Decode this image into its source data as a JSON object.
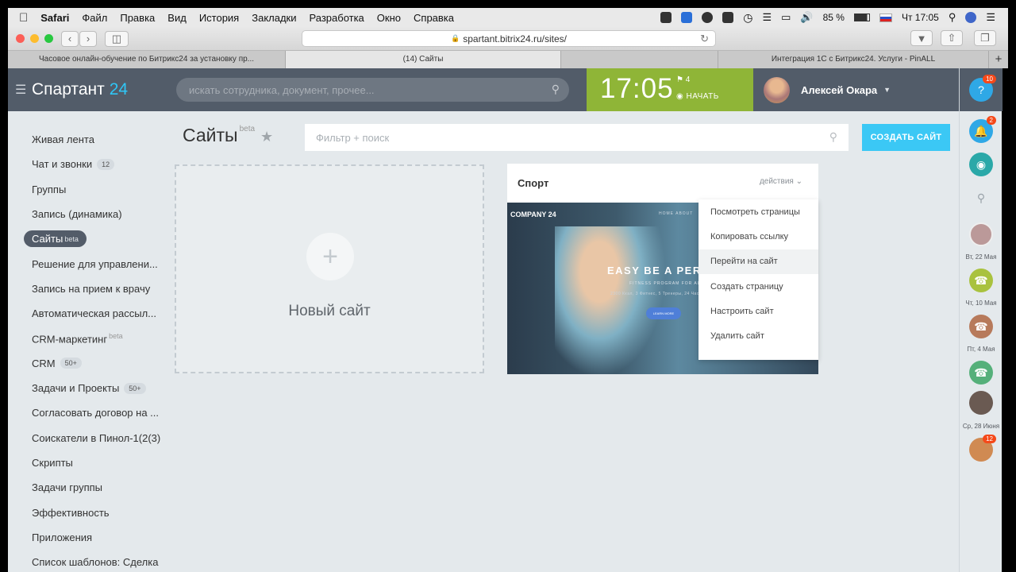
{
  "menubar": {
    "app": "Safari",
    "items": [
      "Файл",
      "Правка",
      "Вид",
      "История",
      "Закладки",
      "Разработка",
      "Окно",
      "Справка"
    ],
    "battery": "85 %",
    "clock": "Чт 17:05"
  },
  "browser": {
    "url": "spartant.bitrix24.ru/sites/",
    "tabs": [
      "Часовое онлайн-обучение по Битрикс24 за установку пр...",
      "(14) Сайты",
      "",
      "Интеграция 1С с Битрикс24. Услуги - PinALL"
    ],
    "new_tab": "+"
  },
  "header": {
    "logo_text": "Спартант",
    "logo_num": "24",
    "search_placeholder": "искать сотрудника, документ, прочее...",
    "time": "17:05",
    "flag_count": "4",
    "start": "НАЧАТЬ",
    "user_name": "Алексей Окара"
  },
  "sidebar": {
    "items": [
      {
        "label": "Живая лента",
        "count": "",
        "sup": ""
      },
      {
        "label": "Чат и звонки",
        "count": "12",
        "sup": ""
      },
      {
        "label": "Группы",
        "count": "",
        "sup": ""
      },
      {
        "label": "Запись (динамика)",
        "count": "",
        "sup": ""
      },
      {
        "label": "Сайты",
        "count": "",
        "sup": "beta",
        "active": true
      },
      {
        "label": "Решение для управлени...",
        "count": "",
        "sup": ""
      },
      {
        "label": "Запись на прием к врачу",
        "count": "",
        "sup": ""
      },
      {
        "label": "Автоматическая рассыл...",
        "count": "",
        "sup": ""
      },
      {
        "label": "CRM-маркетинг",
        "count": "",
        "sup": "beta"
      },
      {
        "label": "CRM",
        "count": "50+",
        "sup": ""
      },
      {
        "label": "Задачи и Проекты",
        "count": "50+",
        "sup": ""
      },
      {
        "label": "Согласовать договор на ...",
        "count": "",
        "sup": ""
      },
      {
        "label": "Соискатели в Пинол-1(2(3)",
        "count": "",
        "sup": ""
      },
      {
        "label": "Скрипты",
        "count": "",
        "sup": ""
      },
      {
        "label": "Задачи группы",
        "count": "",
        "sup": ""
      },
      {
        "label": "Эффективность",
        "count": "",
        "sup": ""
      },
      {
        "label": "Приложения",
        "count": "",
        "sup": ""
      },
      {
        "label": "Список шаблонов: Сделка",
        "count": "",
        "sup": ""
      }
    ]
  },
  "content": {
    "title": "Сайты",
    "title_sup": "beta",
    "filter_placeholder": "Фильтр + поиск",
    "create_button": "СОЗДАТЬ САЙТ",
    "new_site_label": "Новый сайт",
    "new_site_plus": "+"
  },
  "card": {
    "title": "Спорт",
    "actions": "действия",
    "preview": {
      "company": "COMPANY 24",
      "nav": "HOME   ABOUT",
      "headline": "EASY BE A PERFE",
      "sub": "FITNESS PROGRAM FOR ALL",
      "small": "2300 Ккал, 3 Фитнес, 5 Тренеры, 24 Часа",
      "button": "LEARN MORE"
    },
    "menu": [
      "Посмотреть страницы",
      "Копировать ссылку",
      "Перейти на сайт",
      "Создать страницу",
      "Настроить сайт",
      "Удалить сайт"
    ]
  },
  "right_strip": {
    "help_badge": "10",
    "bell_badge": "2",
    "dates": [
      "Вт, 22 Мая",
      "Чт, 10 Мая",
      "Пт, 4 Мая",
      "Ср, 28 Июня"
    ],
    "last_badge": "12"
  }
}
